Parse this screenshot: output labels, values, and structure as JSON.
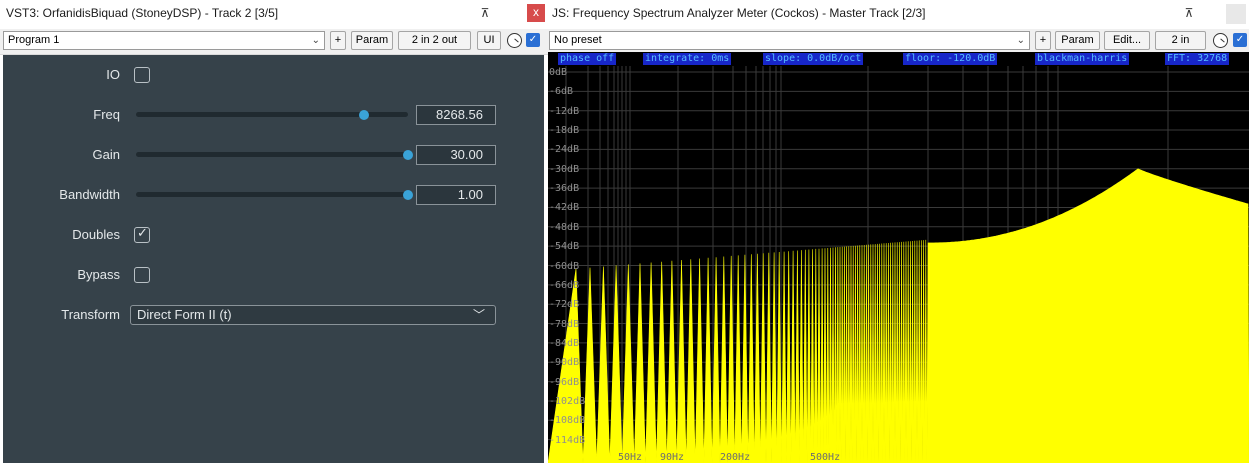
{
  "left_window": {
    "title": "VST3: OrfanidisBiquad (StoneyDSP) - Track 2 [3/5]",
    "pin_icon": "pin-icon",
    "close_label": "x",
    "toolbar": {
      "preset_value": "Program 1",
      "add_label": "+",
      "param_label": "Param",
      "io_label": "2 in 2 out",
      "ui_label": "UI"
    },
    "params": {
      "io": {
        "label": "IO",
        "checked": false
      },
      "freq": {
        "label": "Freq",
        "value": "8268.56",
        "fraction": 0.84
      },
      "gain": {
        "label": "Gain",
        "value": "30.00",
        "fraction": 1.0
      },
      "bandwidth": {
        "label": "Bandwidth",
        "value": "1.00",
        "fraction": 1.0
      },
      "doubles": {
        "label": "Doubles",
        "checked": true,
        "mark": "✓"
      },
      "bypass": {
        "label": "Bypass",
        "checked": false
      },
      "transform": {
        "label": "Transform",
        "value": "Direct Form II (t)"
      }
    }
  },
  "right_window": {
    "title": "JS: Frequency Spectrum Analyzer Meter (Cockos) - Master Track [2/3]",
    "toolbar": {
      "preset_value": "No preset",
      "add_label": "+",
      "param_label": "Param",
      "edit_label": "Edit...",
      "io_label": "2 in"
    },
    "analyzer": {
      "header": [
        "phase off",
        "integrate: 0ms",
        "slope: 0.0dB/oct",
        "floor: -120.0dB",
        "blackman-harris",
        "FFT: 32768"
      ],
      "db_labels": [
        "0dB",
        "-6dB",
        "-12dB",
        "-18dB",
        "-24dB",
        "-30dB",
        "-36dB",
        "-42dB",
        "-48dB",
        "-54dB",
        "-60dB",
        "-66dB",
        "-72dB",
        "-78dB",
        "-84dB",
        "-90dB",
        "-96dB",
        "-102dB",
        "-108dB",
        "-114dB"
      ],
      "freq_labels": [
        "50Hz",
        "90Hz",
        "200Hz",
        "500Hz"
      ],
      "trace_color": "#ffff00",
      "background": "#000000",
      "header_bg": "#1726c9",
      "header_text": "#57bdff"
    }
  },
  "colors": {
    "panel_bg": "#36424a",
    "accent": "#3aa3d8",
    "close_red": "#d74b4b"
  }
}
